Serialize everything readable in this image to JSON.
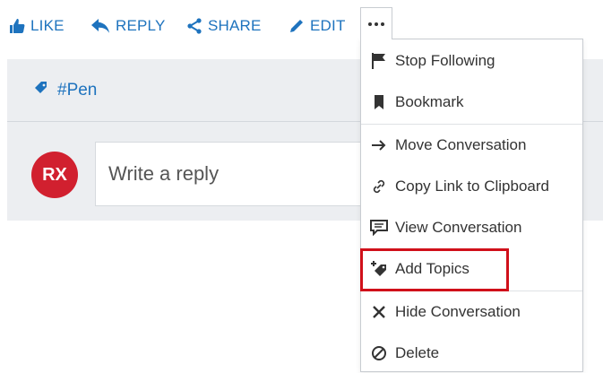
{
  "actions": {
    "like": "LIKE",
    "reply": "REPLY",
    "share": "SHARE",
    "edit": "EDIT",
    "more_icon": "ellipsis-icon"
  },
  "topic": {
    "label": "#Pen",
    "icon": "tag-icon"
  },
  "reply": {
    "avatar_initials": "RX",
    "avatar_color": "#d1202f",
    "placeholder": "Write a reply"
  },
  "menu": {
    "items": [
      {
        "label": "Stop Following",
        "icon": "flag-icon"
      },
      {
        "label": "Bookmark",
        "icon": "bookmark-icon"
      },
      {
        "label": "Move Conversation",
        "icon": "arrow-right-icon"
      },
      {
        "label": "Copy Link to Clipboard",
        "icon": "link-icon"
      },
      {
        "label": "View Conversation",
        "icon": "chat-icon"
      },
      {
        "label": "Add Topics",
        "icon": "add-tag-icon"
      },
      {
        "label": "Hide Conversation",
        "icon": "x-icon"
      },
      {
        "label": "Delete",
        "icon": "ban-icon"
      }
    ],
    "highlighted": "Add Topics"
  },
  "colors": {
    "accent": "#1e73be",
    "highlight": "#d0101a",
    "panel": "#eceef1"
  }
}
